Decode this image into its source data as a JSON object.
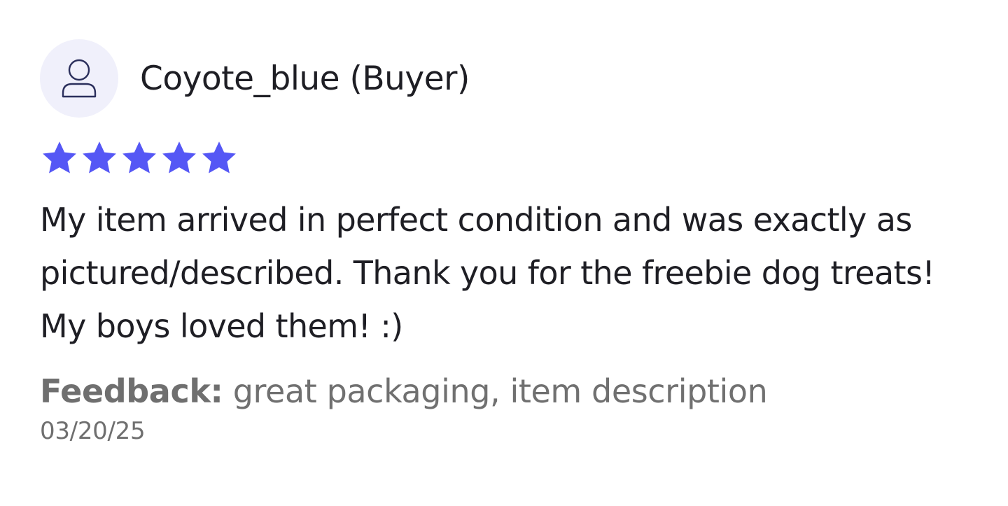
{
  "review": {
    "username": "Coyote_blue (Buyer)",
    "avatar_icon": "user-outline-icon",
    "rating": 5,
    "rating_max": 5,
    "star_color": "#5557f5",
    "text": "My item arrived in perfect condition and was exactly as pictured/described. Thank you for the freebie dog treats! My boys loved them! :)",
    "feedback_label": "Feedback:",
    "feedback_value": "great packaging, item description",
    "date": "03/20/25"
  }
}
